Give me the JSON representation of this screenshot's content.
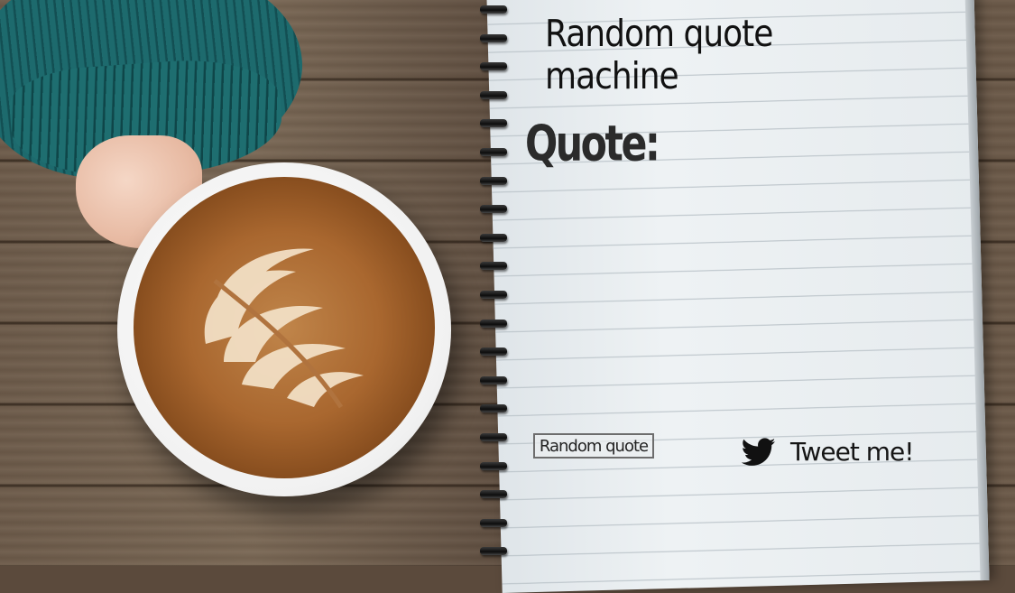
{
  "header": {
    "title": "Random quote machine"
  },
  "quote": {
    "label": "Quote:",
    "text": ""
  },
  "actions": {
    "random_button": "Random quote",
    "tweet_link": "Tweet me!",
    "tweet_icon": "twitter-bird-icon"
  },
  "colors": {
    "text": "#111111",
    "sweater": "#1d6a6d",
    "paper": "#e9eef1",
    "coffee": "#a9672f"
  }
}
